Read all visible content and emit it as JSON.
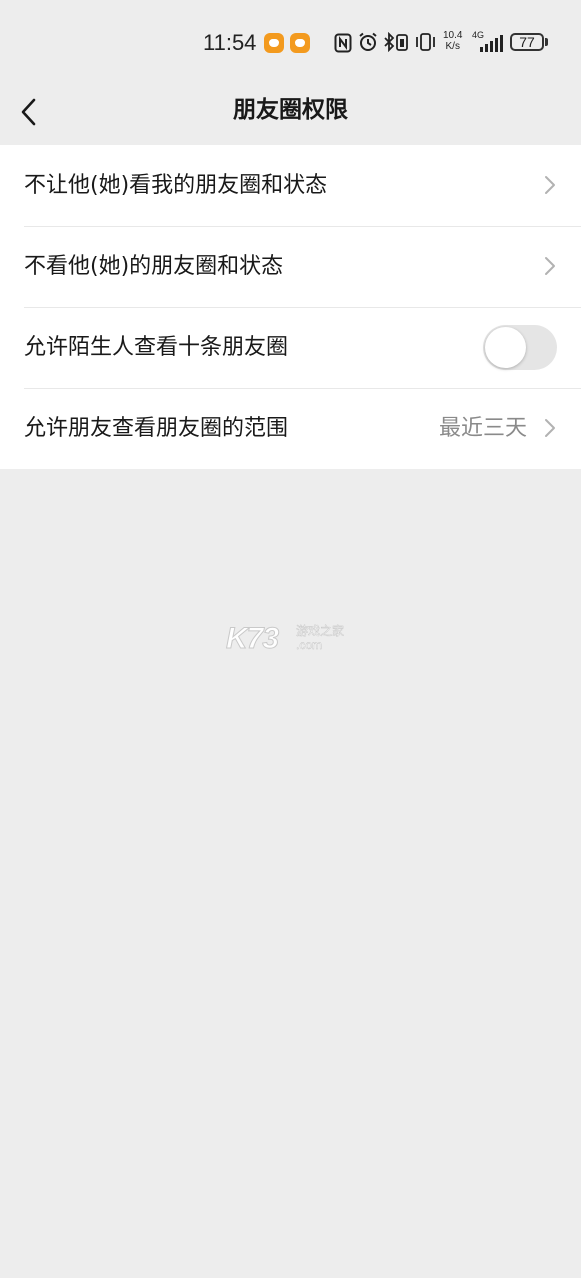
{
  "status_bar": {
    "time": "11:54",
    "net_speed_value": "10.4",
    "net_speed_unit": "K/s",
    "network_type": "4G",
    "battery": "77",
    "icons": [
      "app-badge-icon",
      "app-badge-icon",
      "nfc-icon",
      "alarm-icon",
      "bluetooth-icon",
      "vibrate-icon",
      "signal-icon",
      "battery-icon"
    ]
  },
  "nav": {
    "title": "朋友圈权限",
    "back_icon": "chevron-left-icon"
  },
  "settings": {
    "rows": [
      {
        "label": "不让他(她)看我的朋友圈和状态"
      },
      {
        "label": "不看他(她)的朋友圈和状态"
      },
      {
        "label": "允许陌生人查看十条朋友圈",
        "toggle_on": false
      },
      {
        "label": "允许朋友查看朋友圈的范围",
        "value": "最近三天"
      }
    ]
  },
  "watermark": {
    "brand": "K73",
    "sub": "游戏之家",
    "domain": ".com"
  },
  "colors": {
    "background": "#ededed",
    "card": "#ffffff",
    "text": "#191919",
    "secondary_text": "#8a8a8a",
    "toggle_off": "#e5e5e5"
  }
}
